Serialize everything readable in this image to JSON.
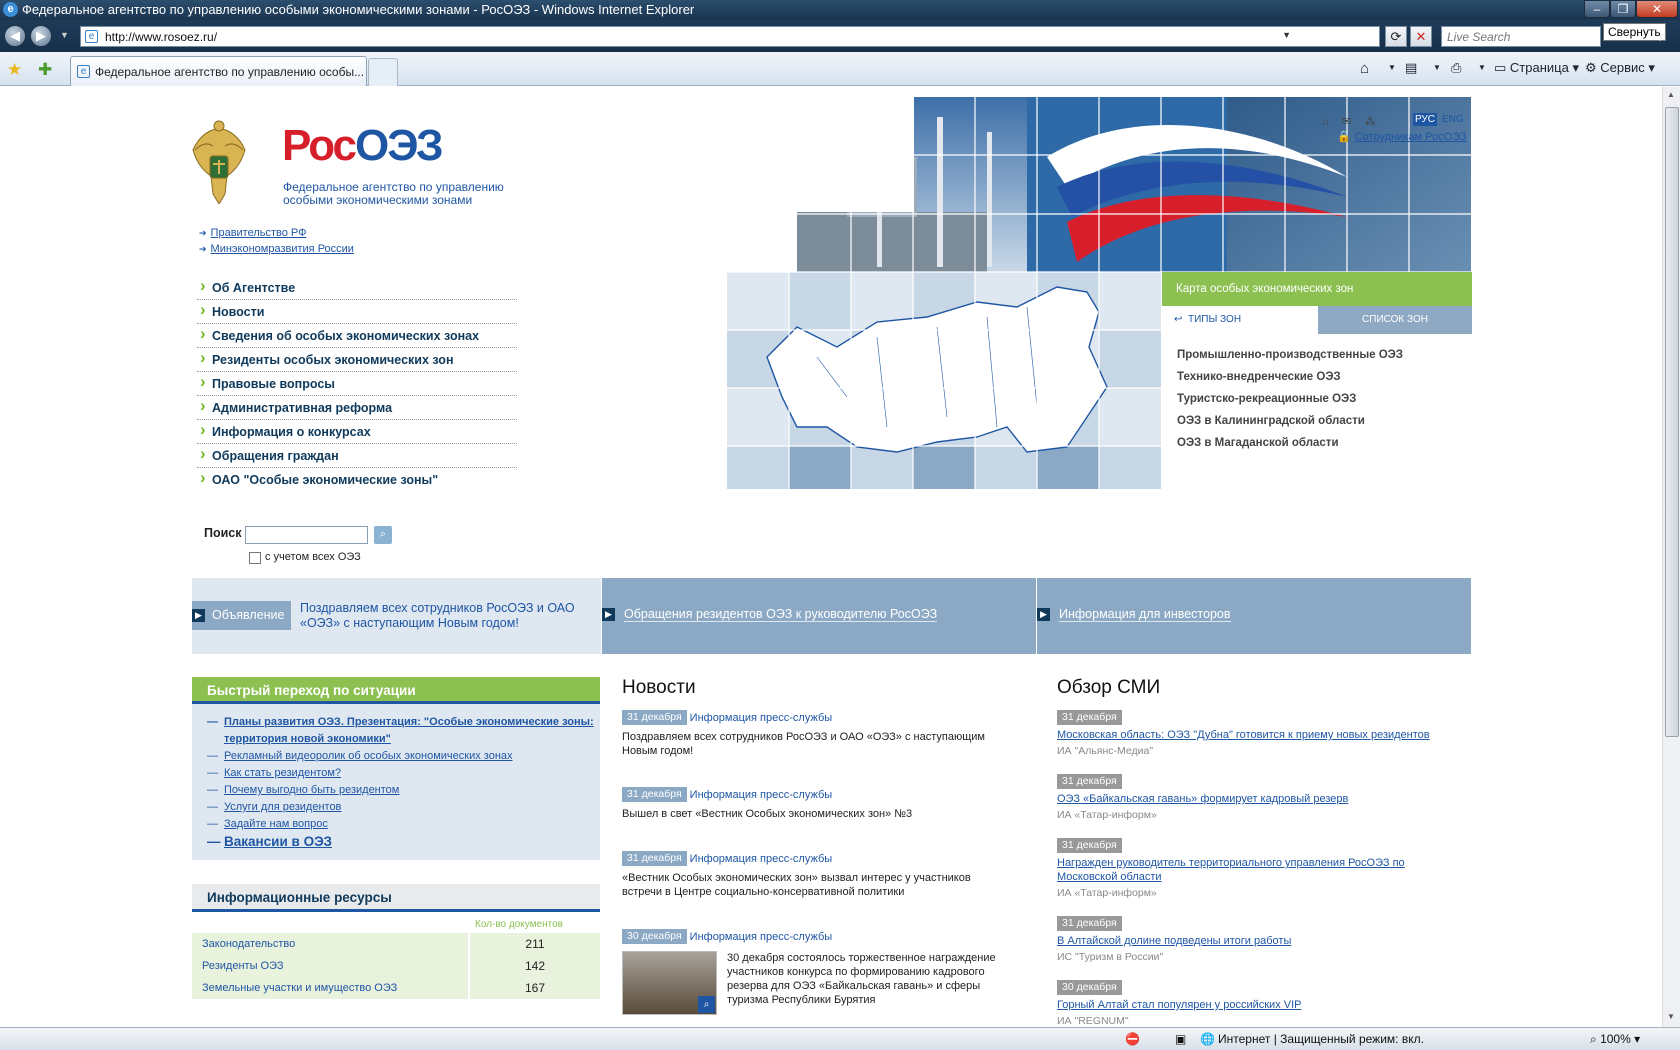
{
  "window": {
    "title": "Федеральное агентство по управлению особыми экономическими зонами - РосОЭЗ - Windows Internet Explorer",
    "minimize_tooltip": "Свернуть"
  },
  "browser": {
    "url": "http://www.rosoez.ru/",
    "search_placeholder": "Live Search",
    "tab_title": "Федеральное агентство по управлению особы...",
    "toolbar": {
      "page": "Страница",
      "tools": "Сервис"
    }
  },
  "status": {
    "zone": "Интернет | Защищенный режим: вкл.",
    "zoom": "100%"
  },
  "logo": {
    "brand_a": "Рос",
    "brand_b": "ОЭЗ",
    "subtitle": "Федеральное агентство по управлению особыми экономическими зонами"
  },
  "top_links": [
    "Правительство РФ",
    "Минэкономразвития России"
  ],
  "nav": [
    "Об Агентстве",
    "Новости",
    "Сведения об особых экономических зонах",
    "Резиденты особых экономических зон",
    "Правовые вопросы",
    "Административная реформа",
    "Информация о конкурсах",
    "Обращения граждан",
    "ОАО \"Особые экономические зоны\""
  ],
  "search": {
    "label": "Поиск",
    "checkbox_label": "с учетом всех ОЭЗ"
  },
  "lang": {
    "ru": "РУС",
    "en": "ENG",
    "staff": "Сотрудникам РосОЭЗ"
  },
  "map": {
    "title": "Карта особых экономических зон",
    "tab_types": "ТИПЫ ЗОН",
    "tab_list": "СПИСОК ЗОН",
    "zones": [
      "Промышленно-производственные ОЭЗ",
      "Технико-внедренческие ОЭЗ",
      "Туристско-рекреационные ОЭЗ",
      "ОЭЗ в Калининградской области",
      "ОЭЗ в Магаданской области"
    ]
  },
  "strip": {
    "announce_label": "Объявление",
    "announce_text": "Поздравляем всех сотрудников РосОЭЗ и ОАО «ОЭЗ» с наступающим Новым годом!",
    "residents": "Обращения резидентов ОЭЗ к руководителю РосОЭЗ",
    "investors": "Информация для инвесторов"
  },
  "quick": {
    "title": "Быстрый переход по ситуации",
    "items": [
      "Планы развития ОЭЗ. Презентация: \"Особые экономические зоны: территория новой экономики\"",
      "Рекламный видеоролик об особых экономических зонах",
      "Как стать резидентом?",
      "Почему выгодно быть резидентом",
      "Услуги для резидентов",
      "Задайте нам вопрос",
      "Вакансии в ОЭЗ"
    ]
  },
  "info": {
    "title": "Информационные ресурсы",
    "col_header": "Кол-во документов",
    "rows": [
      {
        "name": "Законодательство",
        "count": "211"
      },
      {
        "name": "Резиденты ОЭЗ",
        "count": "142"
      },
      {
        "name": "Земельные участки и имущество ОЭЗ",
        "count": "167"
      }
    ]
  },
  "news": {
    "title": "Новости",
    "items": [
      {
        "date": "31 декабря",
        "source": "Информация пресс-службы",
        "text": "Поздравляем всех сотрудников РосОЭЗ и ОАО «ОЭЗ» с наступающим Новым годом!"
      },
      {
        "date": "31 декабря",
        "source": "Информация пресс-службы",
        "text": "Вышел в свет «Вестник Особых экономических зон» №3"
      },
      {
        "date": "31 декабря",
        "source": "Информация пресс-службы",
        "text": "«Вестник Особых экономических зон» вызвал интерес у участников встречи в Центре социально-консервативной политики"
      },
      {
        "date": "30 декабря",
        "source": "Информация пресс-службы",
        "text": "30 декабря состоялось торжественное награждение участников конкурса по формированию кадрового резерва для ОЭЗ «Байкальская гавань» и сферы туризма Республики Бурятия"
      }
    ]
  },
  "media": {
    "title": "Обзор СМИ",
    "items": [
      {
        "date": "31 декабря",
        "title": "Московская область: ОЭЗ \"Дубна\" готовится к приему новых резидентов",
        "source": "ИА \"Альянс-Медиа\""
      },
      {
        "date": "31 декабря",
        "title": "ОЭЗ «Байкальская гавань» формирует кадровый резерв",
        "source": "ИА «Татар-информ»"
      },
      {
        "date": "31 декабря",
        "title": "Награжден руководитель территориального управления РосОЭЗ по Московской области",
        "source": "ИА «Татар-информ»"
      },
      {
        "date": "31 декабря",
        "title": "В Алтайской долине подведены итоги работы",
        "source": "ИС \"Туризм в России\""
      },
      {
        "date": "30 декабря",
        "title": "Горный Алтай стал популярен у российских VIP",
        "source": "ИА \"REGNUM\""
      }
    ]
  },
  "colors": {
    "blue": "#1f56a4",
    "red": "#d71f2b",
    "green": "#8cc152",
    "steel": "#8ba8c4"
  }
}
